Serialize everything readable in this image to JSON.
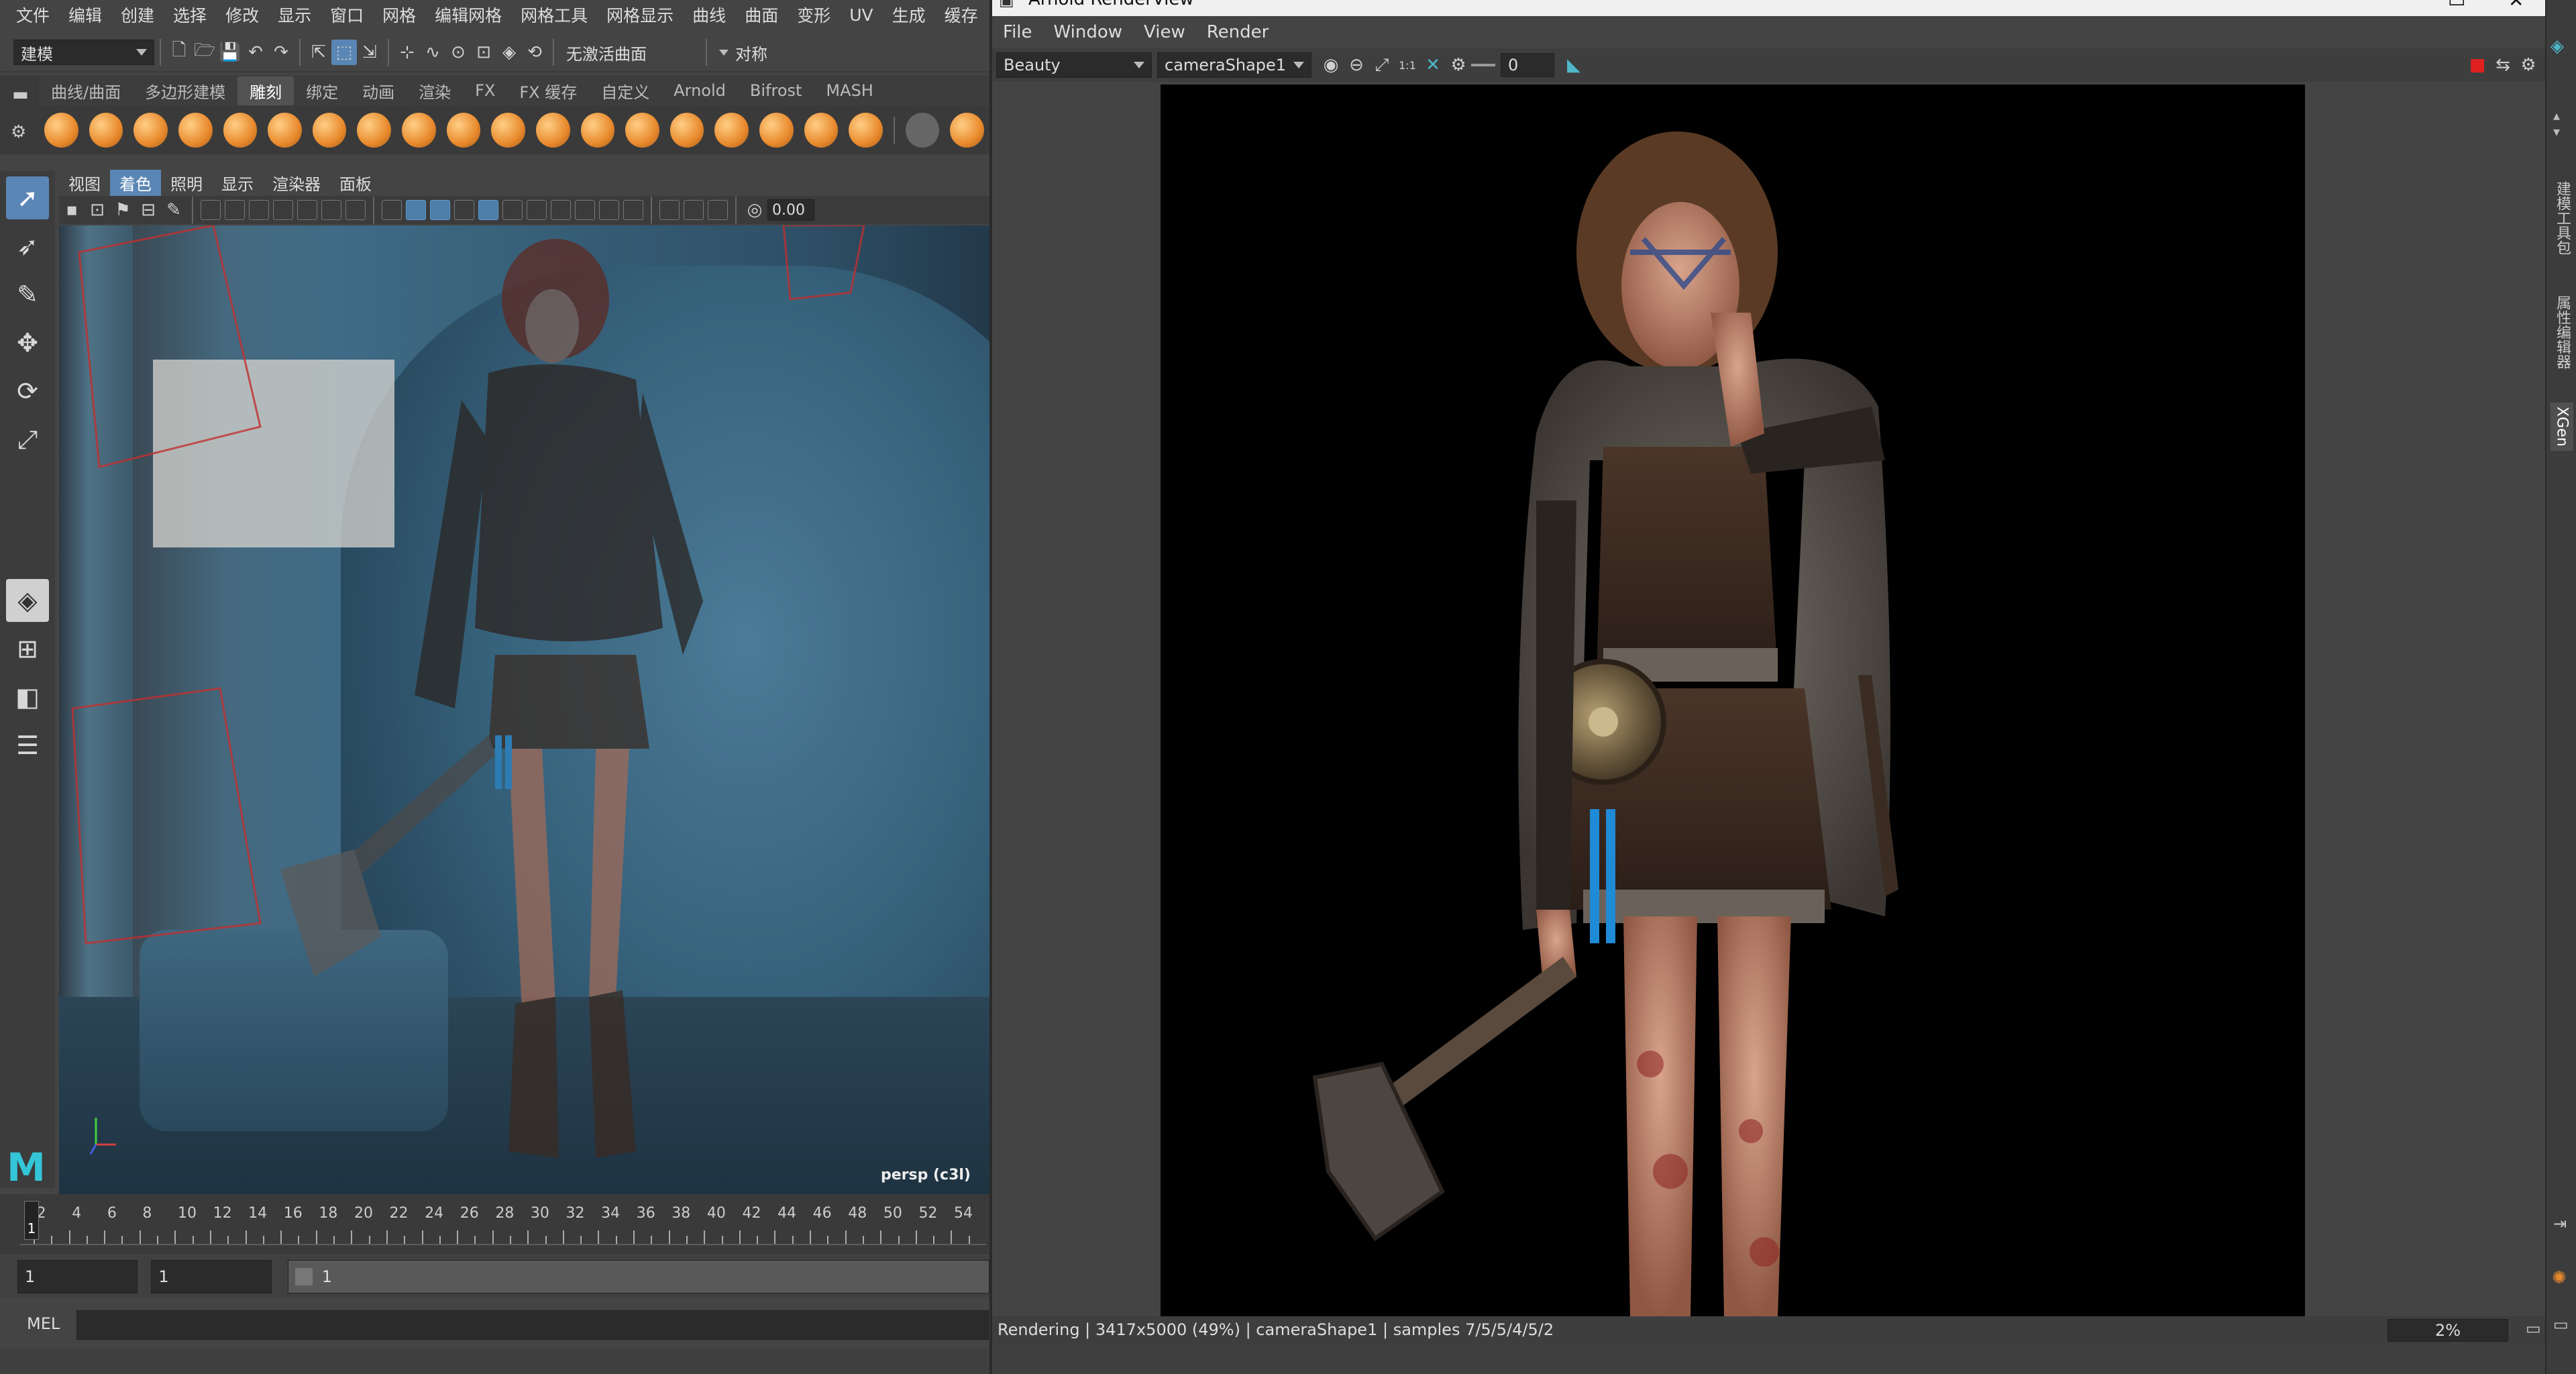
{
  "maya": {
    "menubar": [
      "文件",
      "编辑",
      "创建",
      "选择",
      "修改",
      "显示",
      "窗口",
      "网格",
      "编辑网格",
      "网格工具",
      "网格显示",
      "曲线",
      "曲面",
      "变形",
      "UV",
      "生成",
      "缓存"
    ],
    "status": {
      "mode_combo": "建模",
      "live_surface": "无激活曲面",
      "symmetry_label": "对称"
    },
    "shelf_tabs": [
      "曲线/曲面",
      "多边形建模",
      "雕刻",
      "绑定",
      "动画",
      "渲染",
      "FX",
      "FX 缓存",
      "自定义",
      "Arnold",
      "Bifrost",
      "MASH"
    ],
    "shelf_active": "雕刻",
    "panel_menu": [
      "视图",
      "着色",
      "照明",
      "显示",
      "渲染器",
      "面板"
    ],
    "panel_menu_active": "着色",
    "panel_value": "0.00",
    "camera_label": "persp (c3l)",
    "logo": "M",
    "timeline": {
      "ticks": [
        "2",
        "4",
        "6",
        "8",
        "10",
        "12",
        "14",
        "16",
        "18",
        "20",
        "22",
        "24",
        "26",
        "28",
        "30",
        "32",
        "34",
        "36",
        "38",
        "40",
        "42",
        "44",
        "46",
        "48",
        "50",
        "52",
        "54"
      ],
      "current_frame": "1"
    },
    "range": {
      "start": "1",
      "start_inner": "1",
      "slider_value": "1"
    },
    "cmd_label": "MEL"
  },
  "renderview": {
    "title": "Arnold RenderView",
    "menu": [
      "File",
      "Window",
      "View",
      "Render"
    ],
    "aov": "Beauty",
    "camera": "cameraShape1",
    "ratio_label": "1:1",
    "exposure_value": "0",
    "status_text": "Rendering | 3417x5000 (49%) | cameraShape1 | samples 7/5/5/4/5/2",
    "zoom": "2%"
  },
  "dock": {
    "tabs": [
      "建模工具包",
      "属性编辑器",
      "XGen"
    ],
    "active": "XGen"
  },
  "colors": {
    "accent_blue": "#5a86b5",
    "shelf_orange": "#e8892c",
    "maya_logo": "#34c6d8"
  }
}
